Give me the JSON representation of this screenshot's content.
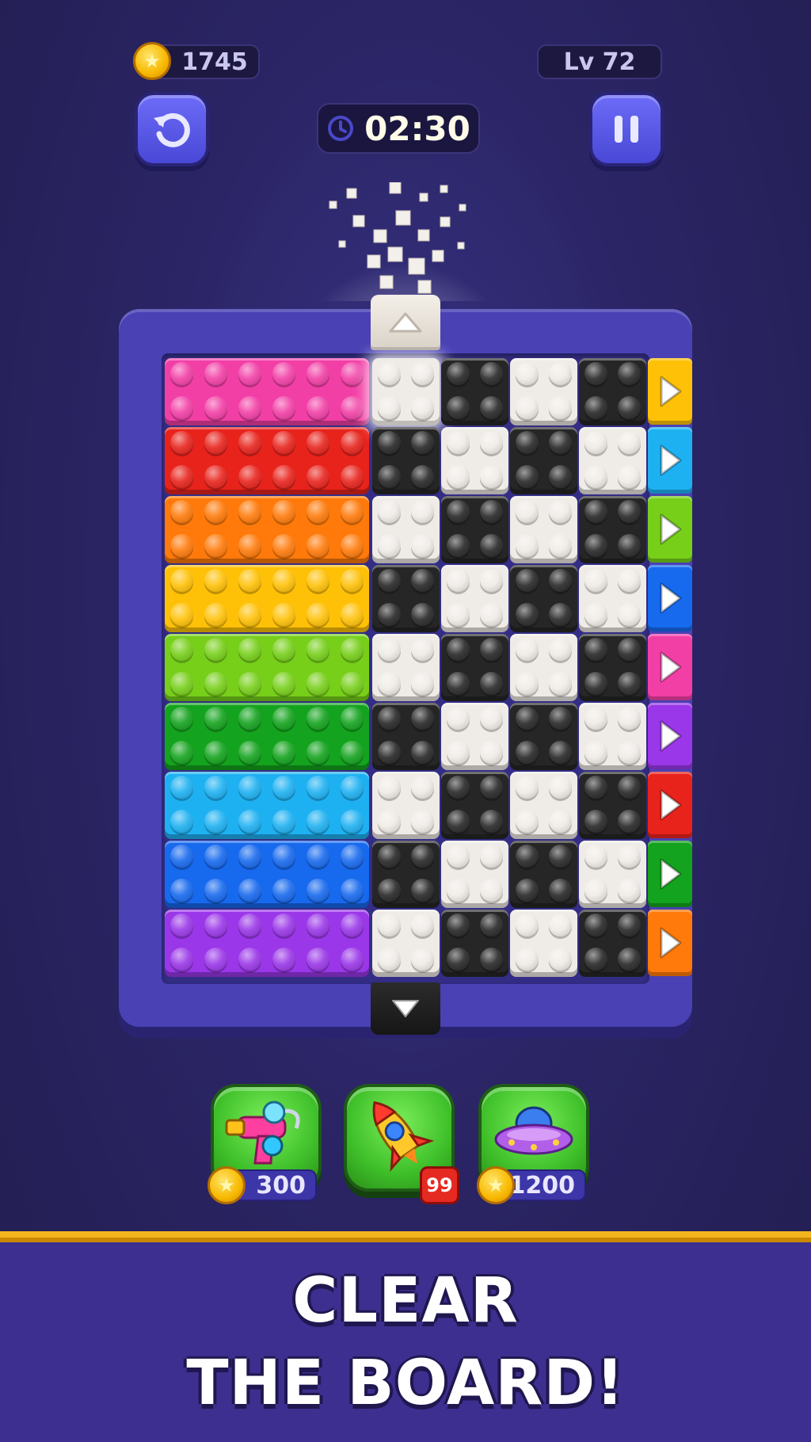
{
  "hud": {
    "coins": "1745",
    "level": "Lv 72",
    "timer": "02:30",
    "undo_icon": "undo-icon",
    "pause_icon": "pause-icon",
    "clock_icon": "clock-icon"
  },
  "board": {
    "colors": {
      "pink": "#f23fa6",
      "red": "#e8231c",
      "orange": "#ff7a0a",
      "yellow": "#ffc107",
      "lime": "#77cf1a",
      "green": "#14a31e",
      "sky": "#1eb1f2",
      "blue": "#1769ee",
      "purple": "#9a37e8",
      "black": "#262626",
      "white": "#efebe6",
      "frame": "#4941b4"
    },
    "long_bricks": [
      "pink",
      "red",
      "orange",
      "yellow",
      "lime",
      "green",
      "sky",
      "blue",
      "purple"
    ],
    "small_grid": [
      [
        "white",
        "black",
        "white",
        "black"
      ],
      [
        "black",
        "white",
        "black",
        "white"
      ],
      [
        "white",
        "black",
        "white",
        "black"
      ],
      [
        "black",
        "white",
        "black",
        "white"
      ],
      [
        "white",
        "black",
        "white",
        "black"
      ],
      [
        "black",
        "white",
        "black",
        "white"
      ],
      [
        "white",
        "black",
        "white",
        "black"
      ],
      [
        "black",
        "white",
        "black",
        "white"
      ],
      [
        "white",
        "black",
        "white",
        "black"
      ]
    ],
    "exit_arrows": [
      "yellow",
      "sky",
      "lime",
      "blue",
      "pink",
      "purple",
      "red",
      "green",
      "orange"
    ],
    "top_exit_icon": "up-arrow-icon",
    "bottom_exit_icon": "down-arrow-icon"
  },
  "boosters": [
    {
      "name": "blaster",
      "icon": "blaster-icon",
      "price": "300"
    },
    {
      "name": "rocket",
      "icon": "rocket-icon",
      "count": "99"
    },
    {
      "name": "ufo",
      "icon": "ufo-icon",
      "price": "1200"
    }
  ],
  "banner": {
    "line1": "CLEAR",
    "line2": "THE BOARD!"
  }
}
